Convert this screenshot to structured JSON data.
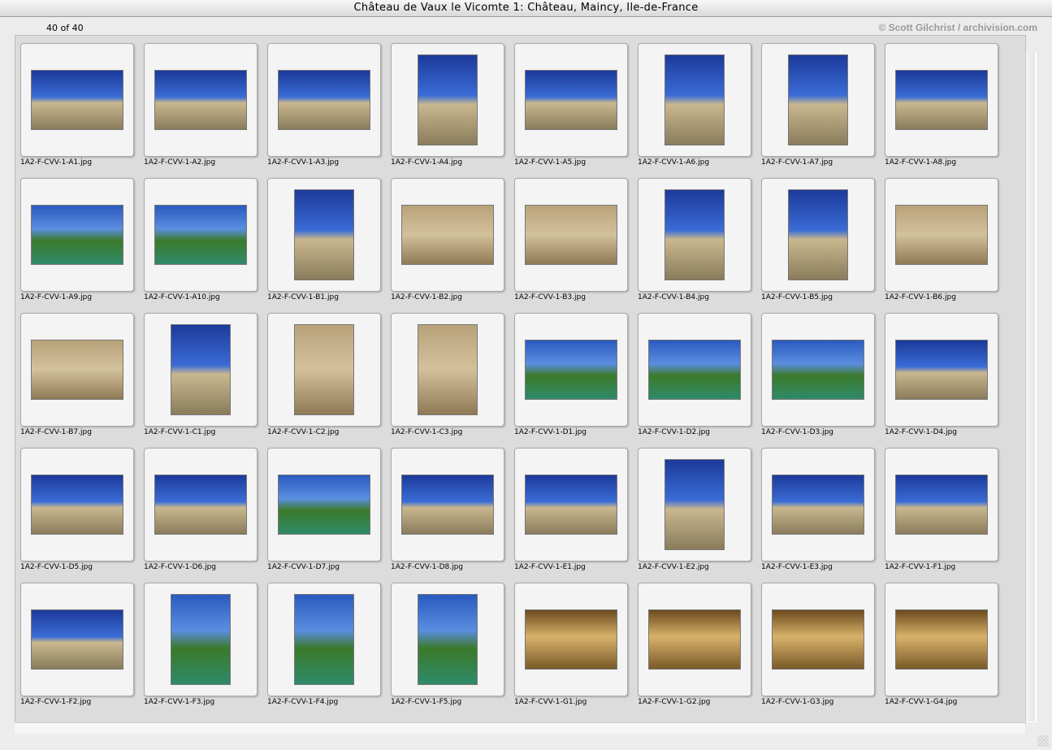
{
  "window": {
    "title": "Château de Vaux le Vicomte 1: Château, Maincy, Ile-de-France"
  },
  "header": {
    "count": "40 of 40",
    "copyright": "© Scott Gilchrist / archivision.com"
  },
  "images": [
    {
      "file": "1A2-F-CVV-1-A1.jpg",
      "orientation": "landscape",
      "style": "sky"
    },
    {
      "file": "1A2-F-CVV-1-A2.jpg",
      "orientation": "landscape",
      "style": "sky"
    },
    {
      "file": "1A2-F-CVV-1-A3.jpg",
      "orientation": "landscape",
      "style": "sky"
    },
    {
      "file": "1A2-F-CVV-1-A4.jpg",
      "orientation": "portrait",
      "style": "sky"
    },
    {
      "file": "1A2-F-CVV-1-A5.jpg",
      "orientation": "landscape",
      "style": "sky"
    },
    {
      "file": "1A2-F-CVV-1-A6.jpg",
      "orientation": "portrait",
      "style": "sky"
    },
    {
      "file": "1A2-F-CVV-1-A7.jpg",
      "orientation": "portrait",
      "style": "sky"
    },
    {
      "file": "1A2-F-CVV-1-A8.jpg",
      "orientation": "landscape",
      "style": "sky"
    },
    {
      "file": "1A2-F-CVV-1-A9.jpg",
      "orientation": "landscape",
      "style": "garden"
    },
    {
      "file": "1A2-F-CVV-1-A10.jpg",
      "orientation": "landscape",
      "style": "garden"
    },
    {
      "file": "1A2-F-CVV-1-B1.jpg",
      "orientation": "portrait",
      "style": "sky"
    },
    {
      "file": "1A2-F-CVV-1-B2.jpg",
      "orientation": "landscape",
      "style": "stone"
    },
    {
      "file": "1A2-F-CVV-1-B3.jpg",
      "orientation": "landscape",
      "style": "stone"
    },
    {
      "file": "1A2-F-CVV-1-B4.jpg",
      "orientation": "portrait",
      "style": "sky"
    },
    {
      "file": "1A2-F-CVV-1-B5.jpg",
      "orientation": "portrait",
      "style": "sky"
    },
    {
      "file": "1A2-F-CVV-1-B6.jpg",
      "orientation": "landscape",
      "style": "stone"
    },
    {
      "file": "1A2-F-CVV-1-B7.jpg",
      "orientation": "landscape",
      "style": "stone"
    },
    {
      "file": "1A2-F-CVV-1-C1.jpg",
      "orientation": "portrait",
      "style": "sky"
    },
    {
      "file": "1A2-F-CVV-1-C2.jpg",
      "orientation": "portrait",
      "style": "stone"
    },
    {
      "file": "1A2-F-CVV-1-C3.jpg",
      "orientation": "portrait",
      "style": "stone"
    },
    {
      "file": "1A2-F-CVV-1-D1.jpg",
      "orientation": "landscape",
      "style": "garden"
    },
    {
      "file": "1A2-F-CVV-1-D2.jpg",
      "orientation": "landscape",
      "style": "garden"
    },
    {
      "file": "1A2-F-CVV-1-D3.jpg",
      "orientation": "landscape",
      "style": "garden"
    },
    {
      "file": "1A2-F-CVV-1-D4.jpg",
      "orientation": "landscape",
      "style": "sky"
    },
    {
      "file": "1A2-F-CVV-1-D5.jpg",
      "orientation": "landscape",
      "style": "sky"
    },
    {
      "file": "1A2-F-CVV-1-D6.jpg",
      "orientation": "landscape",
      "style": "sky"
    },
    {
      "file": "1A2-F-CVV-1-D7.jpg",
      "orientation": "landscape",
      "style": "garden"
    },
    {
      "file": "1A2-F-CVV-1-D8.jpg",
      "orientation": "landscape",
      "style": "sky"
    },
    {
      "file": "1A2-F-CVV-1-E1.jpg",
      "orientation": "landscape",
      "style": "sky"
    },
    {
      "file": "1A2-F-CVV-1-E2.jpg",
      "orientation": "portrait",
      "style": "sky"
    },
    {
      "file": "1A2-F-CVV-1-E3.jpg",
      "orientation": "landscape",
      "style": "sky"
    },
    {
      "file": "1A2-F-CVV-1-F1.jpg",
      "orientation": "landscape",
      "style": "sky"
    },
    {
      "file": "1A2-F-CVV-1-F2.jpg",
      "orientation": "landscape",
      "style": "sky"
    },
    {
      "file": "1A2-F-CVV-1-F3.jpg",
      "orientation": "portrait",
      "style": "garden"
    },
    {
      "file": "1A2-F-CVV-1-F4.jpg",
      "orientation": "portrait",
      "style": "garden"
    },
    {
      "file": "1A2-F-CVV-1-F5.jpg",
      "orientation": "portrait",
      "style": "garden"
    },
    {
      "file": "1A2-F-CVV-1-G1.jpg",
      "orientation": "landscape",
      "style": "interior"
    },
    {
      "file": "1A2-F-CVV-1-G2.jpg",
      "orientation": "landscape",
      "style": "interior"
    },
    {
      "file": "1A2-F-CVV-1-G3.jpg",
      "orientation": "landscape",
      "style": "interior"
    },
    {
      "file": "1A2-F-CVV-1-G4.jpg",
      "orientation": "landscape",
      "style": "interior"
    }
  ]
}
